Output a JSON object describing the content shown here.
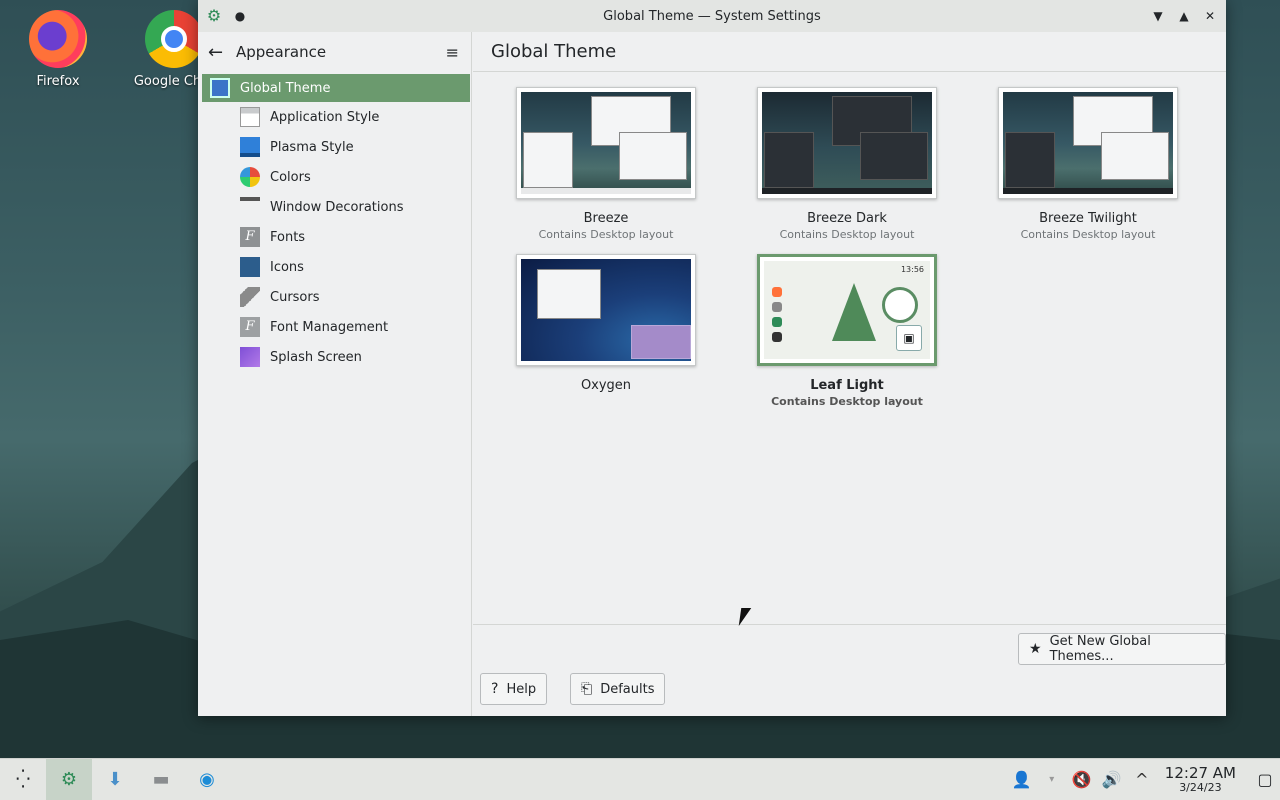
{
  "desktop": {
    "icons": [
      {
        "label": "Firefox",
        "icon": "firefox-icon"
      },
      {
        "label": "Google Chro",
        "icon": "chrome-icon"
      }
    ]
  },
  "window": {
    "title": "Global Theme — System Settings",
    "pin_icon": "●",
    "controls": {
      "minimize": "▼",
      "maximize": "▲",
      "close": "✕"
    }
  },
  "sidebar": {
    "header": "Appearance",
    "back_icon": "arrow-left-icon",
    "menu_icon": "hamburger-icon",
    "top_item": "Global Theme",
    "items": [
      {
        "label": "Application Style",
        "icon": "application-style-icon"
      },
      {
        "label": "Plasma Style",
        "icon": "plasma-style-icon"
      },
      {
        "label": "Colors",
        "icon": "colors-icon"
      },
      {
        "label": "Window Decorations",
        "icon": "window-decorations-icon"
      },
      {
        "label": "Fonts",
        "icon": "fonts-icon"
      },
      {
        "label": "Icons",
        "icon": "icons-icon"
      },
      {
        "label": "Cursors",
        "icon": "cursors-icon"
      },
      {
        "label": "Font Management",
        "icon": "font-management-icon"
      },
      {
        "label": "Splash Screen",
        "icon": "splash-screen-icon"
      }
    ]
  },
  "main": {
    "title": "Global Theme",
    "themes": [
      {
        "name": "Breeze",
        "subtitle": "Contains Desktop layout",
        "selected": false
      },
      {
        "name": "Breeze Dark",
        "subtitle": "Contains Desktop layout",
        "selected": false
      },
      {
        "name": "Breeze Twilight",
        "subtitle": "Contains Desktop layout",
        "selected": false
      },
      {
        "name": "Oxygen",
        "subtitle": "",
        "selected": false
      },
      {
        "name": "Leaf Light",
        "subtitle": "Contains Desktop layout",
        "selected": true
      }
    ],
    "leaf_preview_time": "13:56",
    "get_new_button": "Get New Global Themes...",
    "help_button": "Help",
    "defaults_button": "Defaults"
  },
  "taskbar": {
    "time": "12:27 AM",
    "date": "3/24/23"
  },
  "colors": {
    "accent": "#6b9a6e",
    "window_bg": "#eff0f1",
    "taskbar_bg": "#e4e6e3"
  }
}
